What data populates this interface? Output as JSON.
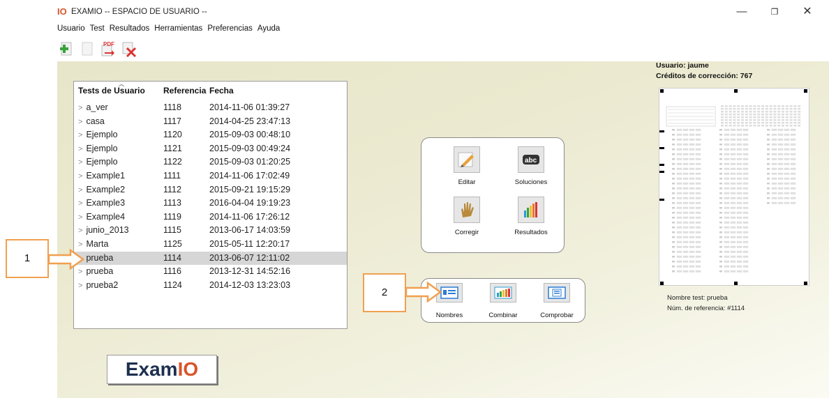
{
  "window": {
    "logo_text": "IO",
    "title": "EXAMIO -- ESPACIO DE USUARIO --",
    "minimize": "—",
    "maximize": "❐",
    "close": "✕"
  },
  "menu": [
    "Usuario",
    "Test",
    "Resultados",
    "Herramientas",
    "Preferencias",
    "Ayuda"
  ],
  "toolbar": [
    {
      "icon": "add-test-icon"
    },
    {
      "icon": "blank-document-icon"
    },
    {
      "icon": "pdf-export-icon",
      "label": "PDF"
    },
    {
      "icon": "delete-test-icon"
    }
  ],
  "user": {
    "label": "Usuario: jaume",
    "credits": "Créditos de corrección: 767"
  },
  "tests": {
    "headers": [
      "Tests de Usuario",
      "Referencia",
      "Fecha"
    ],
    "rows": [
      {
        "name": "a_ver",
        "ref": "1118",
        "date": "2014-11-06 01:39:27"
      },
      {
        "name": "casa",
        "ref": "1117",
        "date": "2014-04-25 23:47:13"
      },
      {
        "name": "Ejemplo",
        "ref": "1120",
        "date": "2015-09-03 00:48:10"
      },
      {
        "name": "Ejemplo",
        "ref": "1121",
        "date": "2015-09-03 00:49:24"
      },
      {
        "name": "Ejemplo",
        "ref": "1122",
        "date": "2015-09-03 01:20:25"
      },
      {
        "name": "Example1",
        "ref": "1111",
        "date": "2014-11-06 17:02:49"
      },
      {
        "name": "Example2",
        "ref": "1112",
        "date": "2015-09-21 19:15:29"
      },
      {
        "name": "Example3",
        "ref": "1113",
        "date": "2016-04-04 19:19:23"
      },
      {
        "name": "Example4",
        "ref": "1119",
        "date": "2014-11-06 17:26:12"
      },
      {
        "name": "junio_2013",
        "ref": "1115",
        "date": "2013-06-17 14:03:59"
      },
      {
        "name": "Marta",
        "ref": "1125",
        "date": "2015-05-11 12:20:17"
      },
      {
        "name": "prueba",
        "ref": "1114",
        "date": "2013-06-07 12:11:02",
        "selected": true
      },
      {
        "name": "prueba",
        "ref": "1116",
        "date": "2013-12-31 14:52:16"
      },
      {
        "name": "prueba2",
        "ref": "1124",
        "date": "2014-12-03 13:23:03"
      }
    ]
  },
  "actions": {
    "edit": "Editar",
    "solutions": "Soluciones",
    "correct": "Corregir",
    "results": "Resultados"
  },
  "tools": {
    "names": "Nombres",
    "combine": "Combinar",
    "check": "Comprobar"
  },
  "preview": {
    "test_name": "Nombre test: prueba",
    "reference": "Núm. de referencia: #1114"
  },
  "callouts": [
    "1",
    "2"
  ],
  "logo": {
    "prefix": "Exam",
    "suffix": "IO"
  },
  "colors": {
    "accent": "#f0a050",
    "brand": "#d9552b",
    "selected_row": "#d6d6d6"
  }
}
